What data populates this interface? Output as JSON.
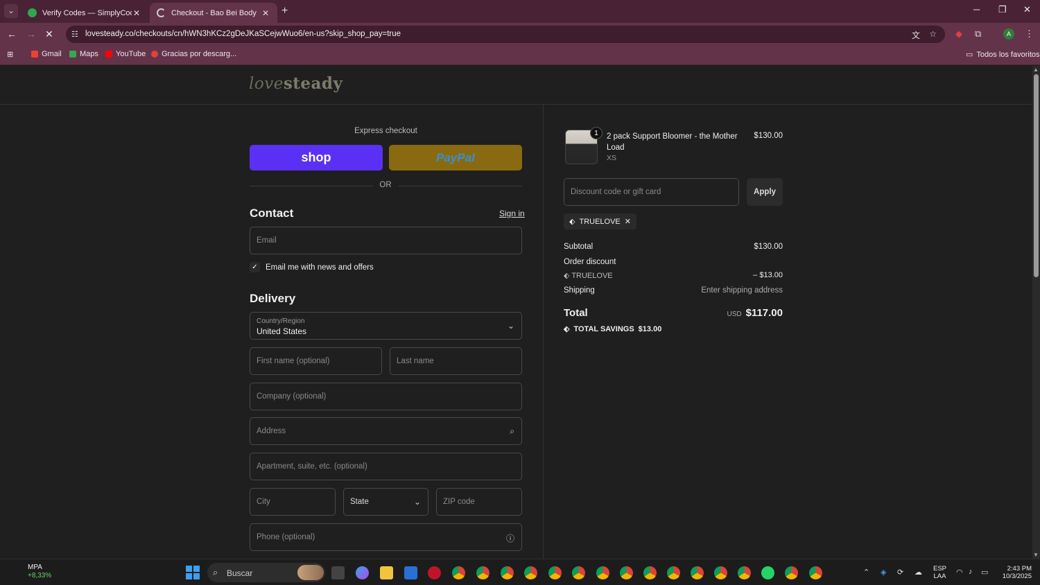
{
  "browser": {
    "tabs": [
      {
        "title": "Verify Codes — SimplyCodes",
        "active": false,
        "favicon_color": "#2fa84f"
      },
      {
        "title": "Checkout - Bao Bei Body",
        "active": true,
        "favicon_color": "#cccccc"
      }
    ],
    "url": "lovesteady.co/checkouts/cn/hWN3hKCz2gDeJKaSCejwWuo6/en-us?skip_shop_pay=true",
    "bookmarks": [
      {
        "label": "Gmail",
        "color": "#ea4335"
      },
      {
        "label": "Maps",
        "color": "#34a853"
      },
      {
        "label": "YouTube",
        "color": "#ff0000"
      },
      {
        "label": "Gracias por descarg...",
        "color": "#e0413a"
      }
    ],
    "all_bookmarks": "Todos los favoritos",
    "profile_initial": "A"
  },
  "checkout": {
    "logo": {
      "part1": "love",
      "part2": "steady"
    },
    "express_label": "Express checkout",
    "shop_pay_label": "shop",
    "paypal_label": "PayPal",
    "or_label": "OR",
    "contact": {
      "heading": "Contact",
      "sign_in": "Sign in",
      "email_placeholder": "Email",
      "newsletter_label": "Email me with news and offers",
      "newsletter_checked": true
    },
    "delivery": {
      "heading": "Delivery",
      "country_label": "Country/Region",
      "country_value": "United States",
      "first_name_placeholder": "First name (optional)",
      "last_name_placeholder": "Last name",
      "company_placeholder": "Company (optional)",
      "address_placeholder": "Address",
      "apartment_placeholder": "Apartment, suite, etc. (optional)",
      "city_placeholder": "City",
      "state_placeholder": "State",
      "zip_placeholder": "ZIP code",
      "phone_placeholder": "Phone (optional)"
    }
  },
  "summary": {
    "item": {
      "quantity": "1",
      "name": "2 pack Support Bloomer - the Mother Load",
      "variant": "XS",
      "price": "$130.00"
    },
    "discount_placeholder": "Discount code or gift card",
    "apply_label": "Apply",
    "applied_code": "TRUELOVE",
    "subtotal_label": "Subtotal",
    "subtotal_value": "$130.00",
    "order_discount_label": "Order discount",
    "discount_code": "TRUELOVE",
    "discount_value": "– $13.00",
    "shipping_label": "Shipping",
    "shipping_value": "Enter shipping address",
    "total_label": "Total",
    "total_currency": "USD",
    "total_value": "$117.00",
    "savings_label": "TOTAL SAVINGS",
    "savings_value": "$13.00"
  },
  "taskbar": {
    "stock_name": "MPA",
    "stock_change": "+8,33%",
    "search_label": "Buscar",
    "lang_top": "ESP",
    "lang_bottom": "LAA",
    "time": "2:43 PM",
    "date": "10/3/2025"
  }
}
